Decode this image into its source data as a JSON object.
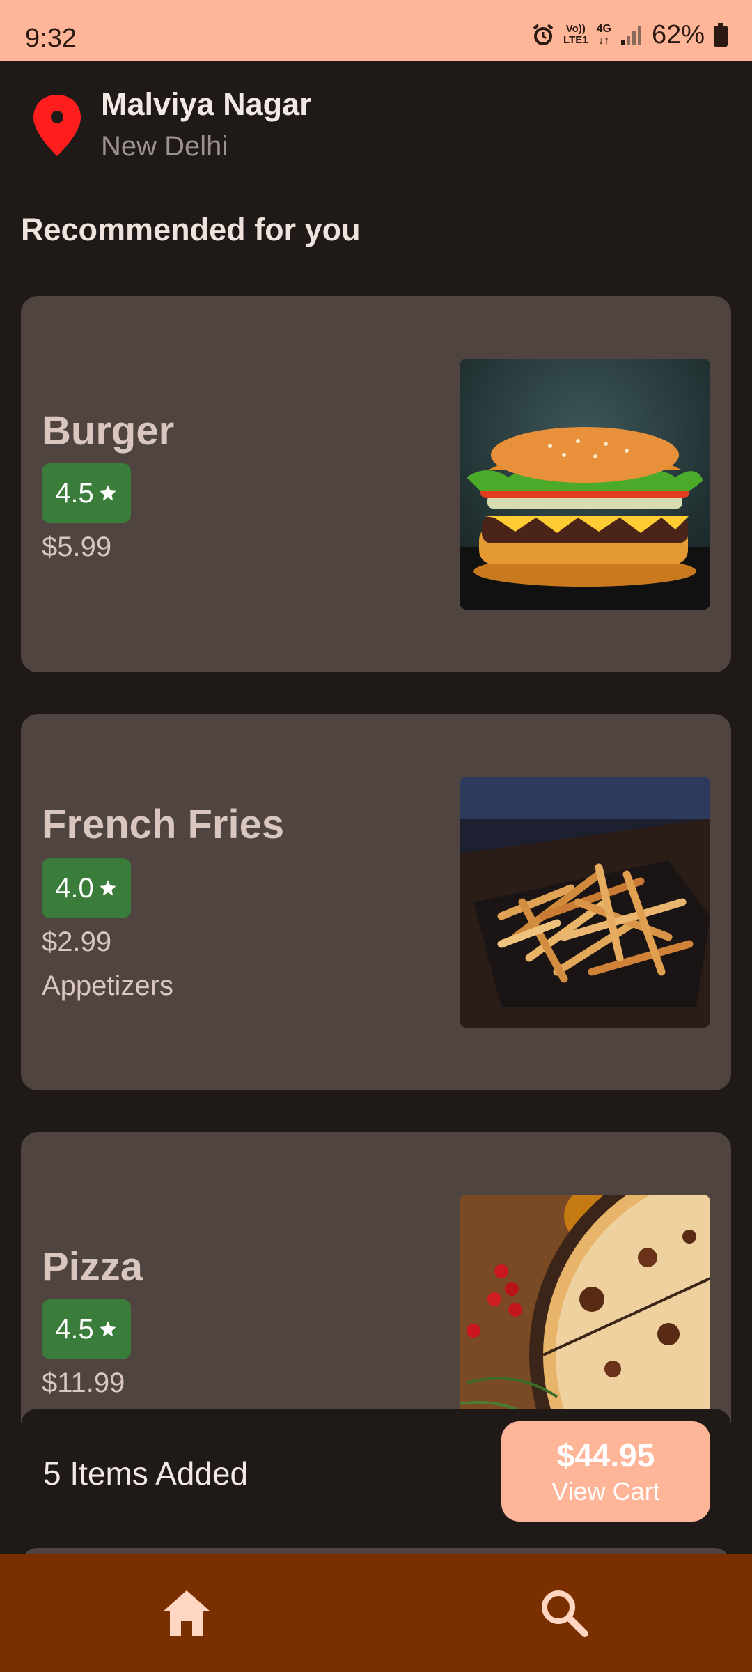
{
  "status_bar": {
    "time": "9:32",
    "volte_line1": "Vo))",
    "volte_line2": "LTE1",
    "network_line1": "4G",
    "network_line2": "↓↑",
    "battery": "62%"
  },
  "location": {
    "title": "Malviya Nagar",
    "subtitle": "New Delhi",
    "pin_color": "#ff1d1d"
  },
  "section_title": "Recommended for you",
  "items": [
    {
      "name": "Burger",
      "rating": "4.5",
      "price": "$5.99",
      "category": ""
    },
    {
      "name": "French Fries",
      "rating": "4.0",
      "price": "$2.99",
      "category": "Appetizers"
    },
    {
      "name": "Pizza",
      "rating": "4.5",
      "price": "$11.99",
      "category": ""
    }
  ],
  "cart": {
    "items_added": "5 Items Added",
    "total": "$44.95",
    "view_label": "View Cart"
  },
  "nav": {
    "items": [
      {
        "icon": "home-icon"
      },
      {
        "icon": "search-icon"
      }
    ]
  },
  "colors": {
    "status_bar": "#ffb597",
    "background": "#1f1a18",
    "card": "#4f4440",
    "rating_badge": "#3a7d3b",
    "accent": "#ffb597",
    "bottom_nav": "#7a2f00"
  }
}
